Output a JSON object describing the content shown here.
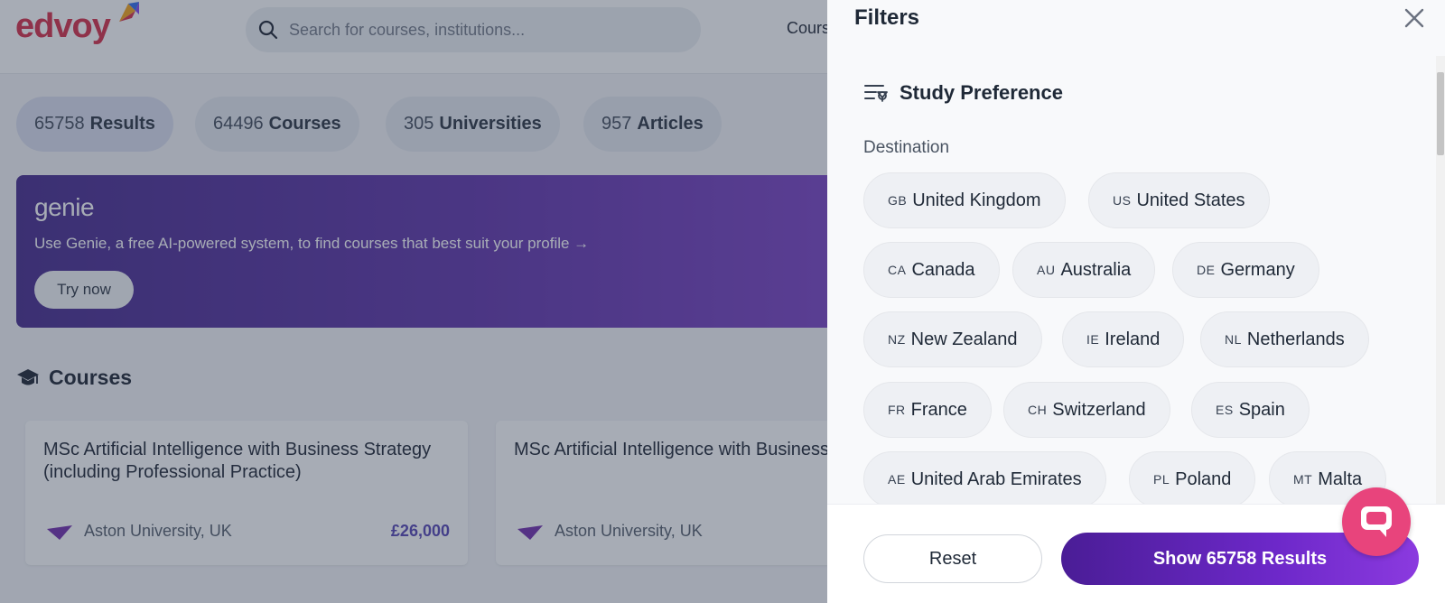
{
  "header": {
    "logo_text": "edvoy",
    "search_placeholder": "Search for courses, institutions...",
    "nav_partial": "Cours"
  },
  "result_pills": [
    {
      "count": "65758",
      "label": "Results"
    },
    {
      "count": "64496",
      "label": "Courses"
    },
    {
      "count": "305",
      "label": "Universities"
    },
    {
      "count": "957",
      "label": "Articles"
    }
  ],
  "banner": {
    "brand": "genie",
    "text": "Use Genie, a free AI-powered system, to find courses that best suit your profile →",
    "cta": "Try now"
  },
  "courses_section": {
    "title": "Courses",
    "cards": [
      {
        "title": "MSc Artificial Intelligence with Business Strategy (including Professional Practice)",
        "university": "Aston University, UK",
        "price": "£26,000"
      },
      {
        "title": "MSc Artificial Intelligence with Business Strategy",
        "university": "Aston University, UK",
        "price": ""
      }
    ]
  },
  "filters": {
    "title": "Filters",
    "section_title": "Study Preference",
    "destination_label": "Destination",
    "destinations": [
      {
        "code": "GB",
        "name": "United Kingdom"
      },
      {
        "code": "US",
        "name": "United States"
      },
      {
        "code": "CA",
        "name": "Canada"
      },
      {
        "code": "AU",
        "name": "Australia"
      },
      {
        "code": "DE",
        "name": "Germany"
      },
      {
        "code": "NZ",
        "name": "New Zealand"
      },
      {
        "code": "IE",
        "name": "Ireland"
      },
      {
        "code": "NL",
        "name": "Netherlands"
      },
      {
        "code": "FR",
        "name": "France"
      },
      {
        "code": "CH",
        "name": "Switzerland"
      },
      {
        "code": "ES",
        "name": "Spain"
      },
      {
        "code": "AE",
        "name": "United Arab Emirates"
      },
      {
        "code": "PL",
        "name": "Poland"
      },
      {
        "code": "MT",
        "name": "Malta"
      }
    ],
    "reset_label": "Reset",
    "show_label": "Show 65758 Results"
  },
  "colors": {
    "brand_red": "#d4213d",
    "primary_purple": "#5b21b6",
    "chat_pink": "#e8447c"
  },
  "icons": [
    "search-icon",
    "graduation-cap-icon",
    "preference-filter-icon",
    "close-icon",
    "chat-icon"
  ]
}
